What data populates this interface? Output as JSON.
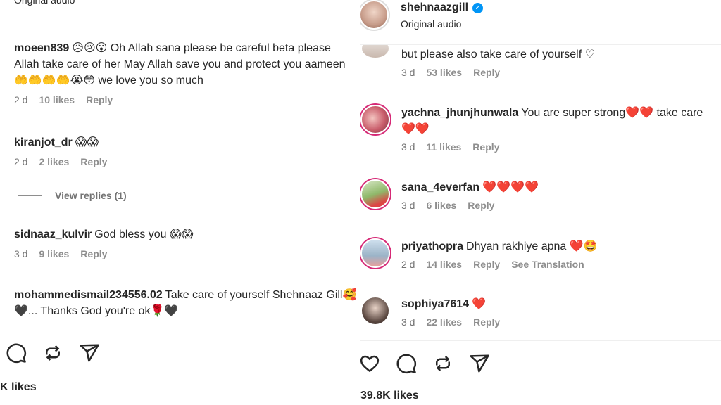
{
  "left": {
    "top_audio": "Original audio",
    "comments": [
      {
        "username": "moeen839",
        "text": "😥😢😮 Oh Allah sana please be careful beta please Allah take care of her May Allah save you and protect you aameen 🤲🤲🤲🤲😭😳 we love you so much",
        "time": "2 d",
        "likes": "10 likes",
        "reply": "Reply"
      },
      {
        "username": "kiranjot_dr",
        "text": "😱😱",
        "time": "2 d",
        "likes": "2 likes",
        "reply": "Reply"
      },
      {
        "username": "sidnaaz_kulvir",
        "text": "God bless you 😱😱",
        "time": "3 d",
        "likes": "9 likes",
        "reply": "Reply"
      },
      {
        "username": "mohammedismail234556.02",
        "text": "Take care of yourself Shehnaaz Gill🥰🖤... Thanks God you're ok🌹🖤",
        "time": "",
        "likes": "",
        "reply": ""
      }
    ],
    "view_replies": "View replies (1)",
    "likes_total": "K likes",
    "icons": [
      "comment-icon",
      "repost-icon",
      "share-icon"
    ]
  },
  "right": {
    "handle": "shehnaazgill",
    "audio": "Original audio",
    "verified_glyph": "✓",
    "comments": [
      {
        "username": "",
        "text": "but please also take care of yourself ♡",
        "time": "3 d",
        "likes": "53 likes",
        "reply": "Reply",
        "translate": ""
      },
      {
        "username": "yachna_jhunjhunwala",
        "text": "You are super strong❤️❤️ take care❤️❤️",
        "time": "3 d",
        "likes": "11 likes",
        "reply": "Reply",
        "translate": ""
      },
      {
        "username": "sana_4everfan",
        "text": "❤️❤️❤️❤️",
        "time": "3 d",
        "likes": "6 likes",
        "reply": "Reply",
        "translate": ""
      },
      {
        "username": "priyathopra",
        "text": "Dhyan rakhiye apna ❤️🤩",
        "time": "2 d",
        "likes": "14 likes",
        "reply": "Reply",
        "translate": "See Translation"
      },
      {
        "username": "sophiya7614",
        "text": "❤️",
        "time": "3 d",
        "likes": "22 likes",
        "reply": "Reply",
        "translate": ""
      }
    ],
    "likes_total": "39.8K likes",
    "icons": [
      "heart-icon",
      "comment-icon",
      "repost-icon",
      "share-icon"
    ]
  },
  "colors": {
    "verified": "#0095f6",
    "heart": "#e0245e",
    "meta": "#737373"
  }
}
